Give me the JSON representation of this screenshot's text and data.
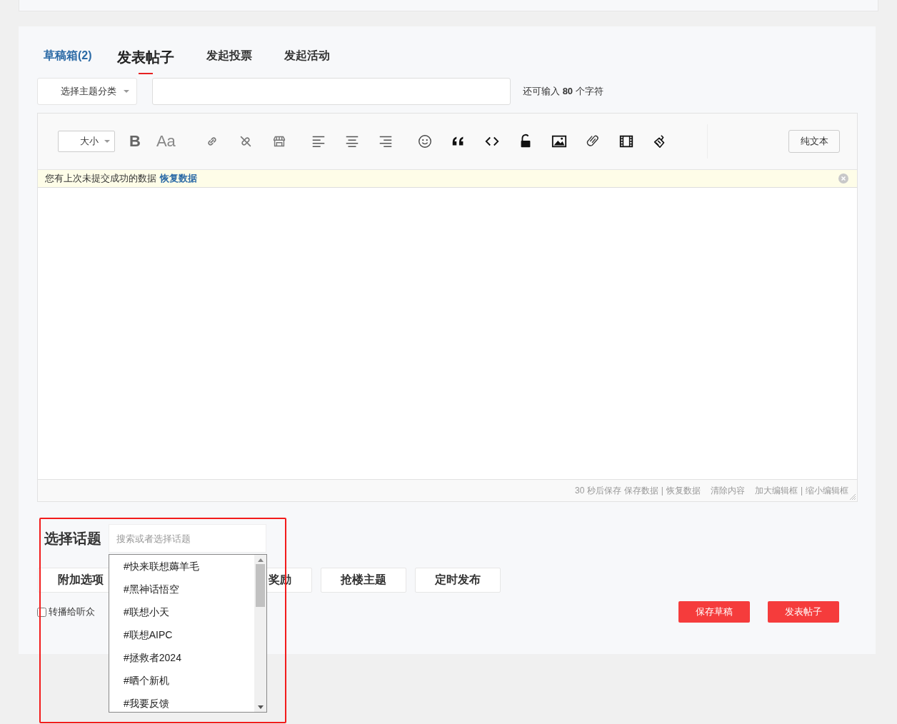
{
  "drafts_link": "草稿箱(2)",
  "tabs": [
    {
      "label": "发表帖子",
      "kind": "tab",
      "selected": true
    },
    {
      "label": "发起投票",
      "kind": "tab",
      "selected": false
    },
    {
      "label": "发起活动",
      "kind": "tab",
      "selected": false
    }
  ],
  "subject": {
    "category": "选择主题分类",
    "remaining_prefix": "还可输入",
    "remaining_count": "80",
    "remaining_suffix": "个字符"
  },
  "toolbar": {
    "size_select": "大小",
    "tools": [
      {
        "kind": "bold",
        "label": "B"
      },
      {
        "kind": "font",
        "label": "Aa"
      },
      {
        "kind": "link"
      },
      {
        "kind": "unlink"
      },
      {
        "kind": "store"
      },
      {
        "kind": "align-left"
      },
      {
        "kind": "align-center"
      },
      {
        "kind": "align-right"
      },
      {
        "kind": "smiley"
      },
      {
        "kind": "quote"
      },
      {
        "kind": "code"
      },
      {
        "kind": "lock"
      },
      {
        "kind": "image"
      },
      {
        "kind": "paperclip"
      },
      {
        "kind": "film"
      },
      {
        "kind": "brush"
      }
    ],
    "plain_text_button": "纯文本"
  },
  "notice": {
    "text": "您有上次未提交成功的数据",
    "link": "恢复数据"
  },
  "editor_footer": {
    "autosave": "30 秒后保存",
    "save": "保存数据",
    "separator_1": "|",
    "restore": "恢复数据",
    "clear": "清除内容",
    "enlarge": "加大编辑框",
    "separator_2": "|",
    "shrink": "缩小编辑框"
  },
  "topic": {
    "label": "选择话题",
    "placeholder": "搜索或者选择话题",
    "options": [
      "#快来联想薅羊毛",
      "#黑神话悟空",
      "#联想小天",
      "#联想AIPC",
      "#拯救者2024",
      "#晒个新机",
      "#我要反馈"
    ]
  },
  "option_buttons": [
    "附加选项",
    "奖励",
    "抢楼主题",
    "定时发布"
  ],
  "broadcast": {
    "label": "转播给听众",
    "checked": false
  },
  "actions": [
    "保存草稿",
    "发表帖子"
  ],
  "annotation_box": true
}
